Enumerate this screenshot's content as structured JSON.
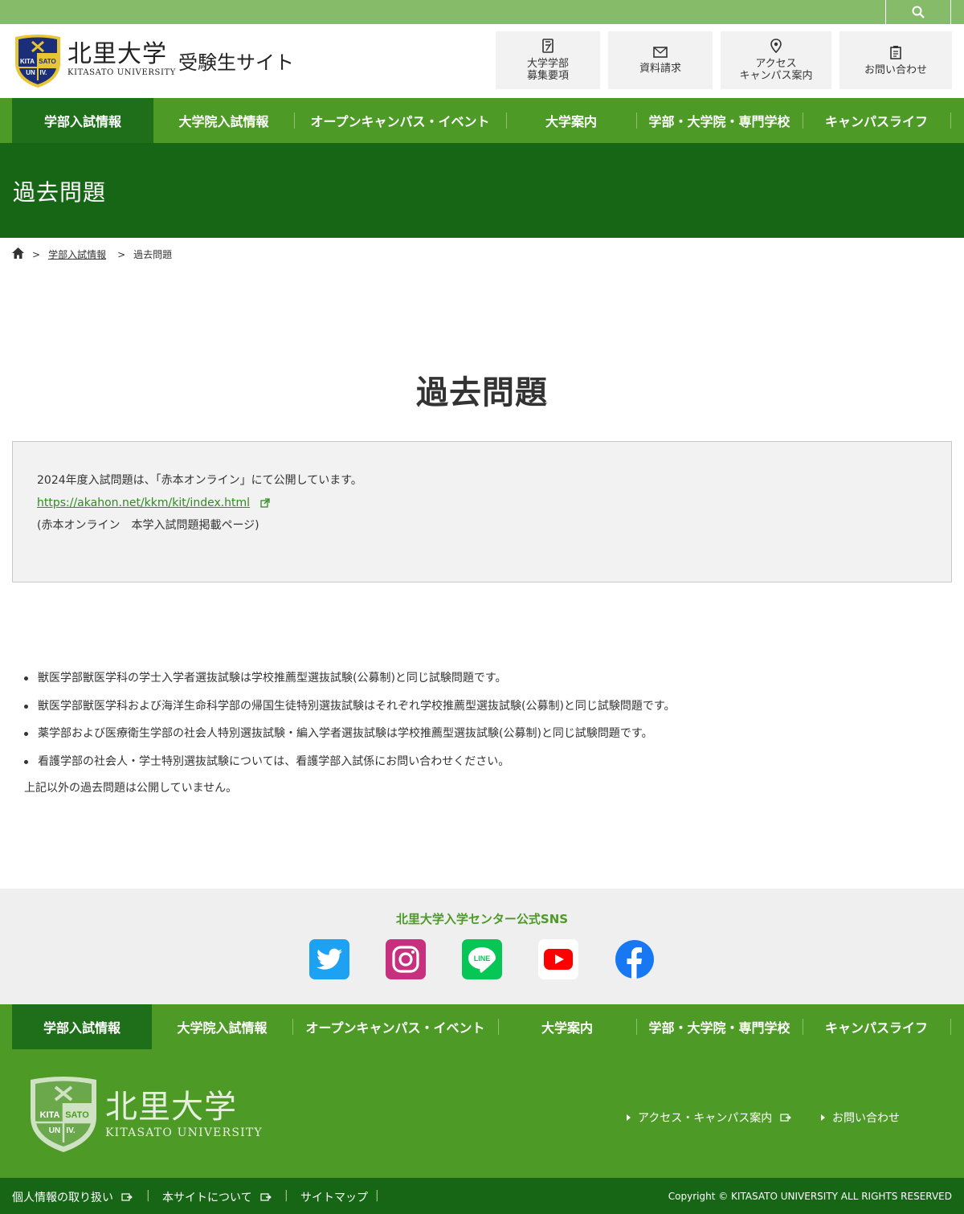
{
  "header": {
    "brand_jp": "北里大学",
    "brand_en": "KITASATO UNIVERSITY",
    "site_name": "受験生サイト",
    "logo_text_tl": "KITA",
    "logo_text_tr": "SATO",
    "logo_text_bl": "UN",
    "logo_text_br": "IV.",
    "buttons": [
      {
        "line1": "大学学部",
        "line2": "募集要項",
        "icon": "book-icon"
      },
      {
        "line1": "資料請求",
        "line2": "",
        "icon": "mail-icon"
      },
      {
        "line1": "アクセス",
        "line2": "キャンパス案内",
        "icon": "map-pin-icon"
      },
      {
        "line1": "お問い合わせ",
        "line2": "",
        "icon": "clipboard-icon"
      }
    ]
  },
  "nav": [
    "学部入試情報",
    "大学院入試情報",
    "オープンキャンパス・イベント",
    "大学案内",
    "学部・大学院・専門学校",
    "キャンパスライフ"
  ],
  "page": {
    "band_title": "過去問題",
    "heading": "過去問題"
  },
  "breadcrumb": {
    "sep": ">",
    "level1": "学部入試情報",
    "current": "過去問題"
  },
  "infobox": {
    "line1": "2024年度入試問題は、「赤本オンライン」にて公開しています。",
    "url": "https://akahon.net/kkm/kit/index.html",
    "line3": "(赤本オンライン　本学入試問題掲載ページ)"
  },
  "notes": [
    "獣医学部獣医学科の学士入学者選抜試験は学校推薦型選抜試験(公募制)と同じ試験問題です。",
    "獣医学部獣医学科および海洋生命科学部の帰国生徒特別選抜試験はそれぞれ学校推薦型選抜試験(公募制)と同じ試験問題です。",
    "薬学部および医療衛生学部の社会人特別選抜試験・編入学者選抜試験は学校推薦型選抜試験(公募制)と同じ試験問題です。",
    "看護学部の社会人・学士特別選抜試験については、看護学部入試係にお問い合わせください。"
  ],
  "notes_footer": "上記以外の過去問題は公開していません。",
  "sns": {
    "title": "北里大学入学センター公式SNS",
    "line_label": "LINE",
    "icons": [
      "twitter-icon",
      "instagram-icon",
      "line-icon",
      "youtube-icon",
      "facebook-icon"
    ]
  },
  "footer": {
    "brand_jp": "北里大学",
    "brand_en": "KITASATO UNIVERSITY",
    "access_link": "アクセス・キャンパス案内",
    "contact_link": "お問い合わせ",
    "bottom_links": [
      "個人情報の取り扱い",
      "本サイトについて",
      "サイトマップ"
    ],
    "pipe": "|",
    "copyright": "Copyright © KITASATO UNIVERSITY ALL RIGHTS RESERVED"
  },
  "colors": {
    "topbar": "#86bb6a",
    "nav": "#4e9a26",
    "nav_active": "#1e6e1a",
    "title_band": "#166616",
    "link": "#2e8b1e"
  }
}
